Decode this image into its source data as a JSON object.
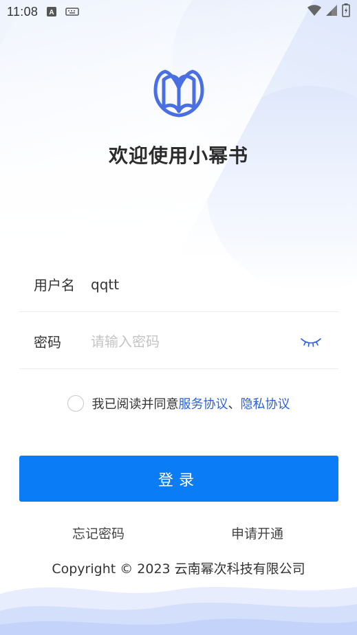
{
  "status_bar": {
    "time": "11:08",
    "left_icons": [
      "text-a-icon",
      "keyboard-icon"
    ],
    "right_icons": [
      "wifi-icon",
      "signal-icon",
      "battery-icon"
    ]
  },
  "app": {
    "title": "欢迎使用小幂书",
    "logo_icon": "book-butterfly-logo",
    "logo_color": "#4a6fe3"
  },
  "form": {
    "username_label": "用户名",
    "username_value": "qqtt",
    "password_label": "密码",
    "password_placeholder": "请输入密码",
    "password_toggle_icon": "eye-closed-icon"
  },
  "agreement": {
    "checked": false,
    "prefix": "我已阅读并同意",
    "service_link": "服务协议",
    "separator": "、",
    "privacy_link": "隐私协议",
    "link_color": "#2b62d9"
  },
  "login_button": {
    "label": "登录",
    "color": "#0a7cf5"
  },
  "links": {
    "forgot_password": "忘记密码",
    "apply_account": "申请开通"
  },
  "footer": {
    "copyright": "Copyright © 2023 云南幂次科技有限公司"
  }
}
